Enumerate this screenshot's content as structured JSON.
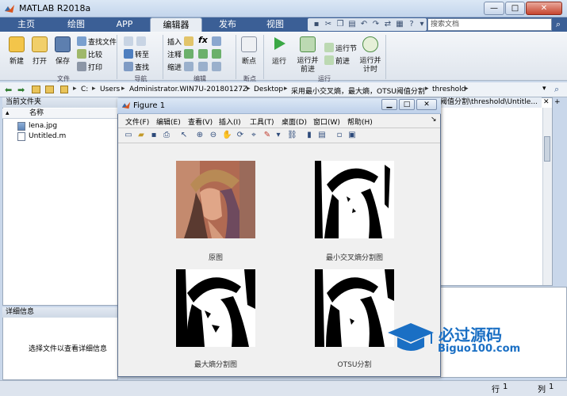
{
  "app": {
    "title": "MATLAB R2018a"
  },
  "window_controls": {
    "minimize": "—",
    "maximize": "□",
    "close": "✕"
  },
  "tabs": [
    {
      "label": "主页"
    },
    {
      "label": "绘图"
    },
    {
      "label": "APP"
    },
    {
      "label": "编辑器"
    },
    {
      "label": "发布"
    },
    {
      "label": "视图"
    }
  ],
  "search": {
    "placeholder": "搜索文档"
  },
  "ribbon": {
    "file": {
      "new": "新建",
      "open": "打开",
      "save": "保存",
      "find_files": "查找文件",
      "compare": "比较",
      "print": "打印",
      "group": "文件"
    },
    "nav": {
      "goto": "转至",
      "find": "查找",
      "group": "导航"
    },
    "edit": {
      "insert": "插入",
      "comment": "注释",
      "indent": "缩进",
      "group": "编辑"
    },
    "breakpoint": {
      "label": "断点",
      "group": "断点"
    },
    "run": {
      "run": "运行",
      "run_advance_1": "运行并",
      "run_advance_2": "前进",
      "run_section": "运行节",
      "advance": "前进",
      "run_time_1": "运行并",
      "run_time_2": "计时",
      "group": "运行"
    }
  },
  "address": {
    "crumbs": [
      "C:",
      "Users",
      "Administrator.WIN7U-20180127Z",
      "Desktop",
      "采用最小交叉熵，最大熵，OTSU阈值分割",
      "threshold"
    ]
  },
  "folder_panel": {
    "title": "当前文件夹",
    "column": "名称",
    "files": [
      "lena.jpg",
      "Untitled.m"
    ]
  },
  "details_panel": {
    "title": "详细信息",
    "message": "选择文件以查看详细信息"
  },
  "editor": {
    "tab": "阈值分割\\threshold\\Untitle..."
  },
  "figure": {
    "title": "Figure 1",
    "menu": [
      "文件(F)",
      "编辑(E)",
      "查看(V)",
      "插入(I)",
      "工具(T)",
      "桌面(D)",
      "窗口(W)",
      "帮助(H)"
    ],
    "captions": [
      "原图",
      "最小交叉熵分割图",
      "最大熵分割图",
      "OTSU分割"
    ]
  },
  "statusbar": {
    "row_label": "行",
    "row_value": "1",
    "col_label": "列",
    "col_value": "1"
  },
  "watermark": {
    "text": "必过源码",
    "url": "Biguo100.com"
  },
  "colors": {
    "tabstrip": "#3b5f96",
    "titlebar": "#c3d5ec",
    "watermark": "#1a6fc4"
  }
}
